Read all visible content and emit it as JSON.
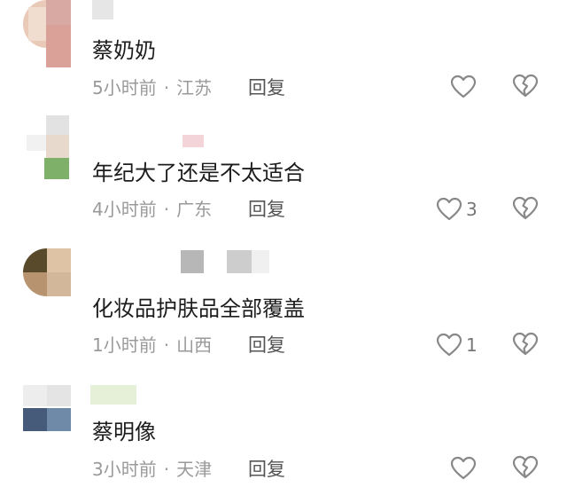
{
  "comments": [
    {
      "text": "蔡奶奶",
      "time": "5小时前",
      "separator": "·",
      "location": "江苏",
      "reply_label": "回复",
      "likes": "",
      "like_icon": "heart-outline-icon",
      "dislike_icon": "broken-heart-icon"
    },
    {
      "text": "年纪大了还是不太适合",
      "time": "4小时前",
      "separator": "·",
      "location": "广东",
      "reply_label": "回复",
      "likes": "3",
      "like_icon": "heart-outline-icon",
      "dislike_icon": "broken-heart-icon"
    },
    {
      "text": "化妆品护肤品全部覆盖",
      "time": "1小时前",
      "separator": "·",
      "location": "山西",
      "reply_label": "回复",
      "likes": "1",
      "like_icon": "heart-outline-icon",
      "dislike_icon": "broken-heart-icon"
    },
    {
      "text": "蔡明像",
      "time": "3小时前",
      "separator": "·",
      "location": "天津",
      "reply_label": "回复",
      "likes": "",
      "like_icon": "heart-outline-icon",
      "dislike_icon": "broken-heart-icon"
    }
  ],
  "colors": {
    "icon_stroke": "#888888",
    "meta_text": "#9a9a9a",
    "reply_text": "#555555"
  }
}
